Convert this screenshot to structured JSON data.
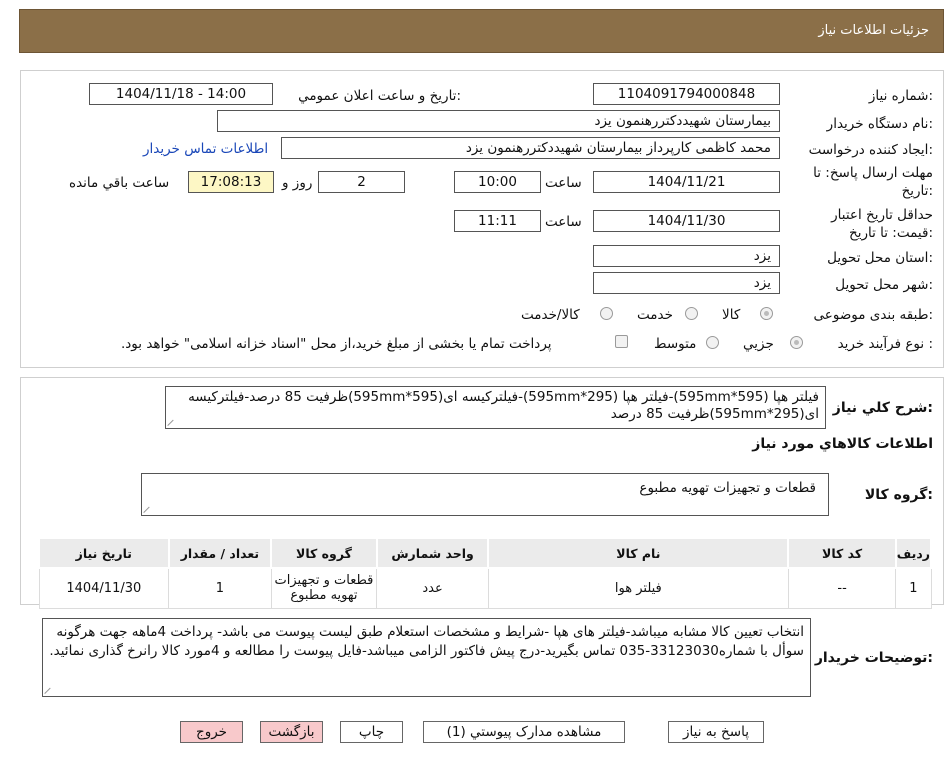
{
  "header": {
    "title": "جزئيات اطلاعات نياز"
  },
  "form": {
    "need_number_label": "شماره نياز:",
    "need_number": "1104091794000848",
    "announce_label": "تاريخ و ساعت اعلان عمومي:",
    "announce_value": "1404/11/18 - 14:00",
    "buyer_org_label": "نام دستگاه خريدار:",
    "buyer_org": "بیمارستان شهیددکتررهنمون یزد",
    "requester_label": "ايجاد کننده درخواست:",
    "requester": "محمد کاظمی کارپرداز بیمارستان شهیددکتررهنمون یزد",
    "contact_link": "اطلاعات تماس خريدار",
    "reply_deadline_label_1": "مهلت ارسال پاسخ: تا",
    "reply_deadline_label_2": "تاريخ:",
    "reply_date": "1404/11/21",
    "time_label": "ساعت",
    "reply_time": "10:00",
    "days_value": "2",
    "days_label": "روز و",
    "remaining_time": "17:08:13",
    "remaining_label": "ساعت باقي مانده",
    "validity_label_1": "حداقل تاريخ اعتبار",
    "validity_label_2": "قيمت: تا تاريخ:",
    "validity_date": "1404/11/30",
    "validity_time": "11:11",
    "province_label": "استان محل تحويل:",
    "province": "یزد",
    "city_label": "شهر محل تحويل:",
    "city": "یزد",
    "category_label": "طبقه بندی موضوعی:",
    "category_options": [
      "کالا",
      "خدمت",
      "کالا/خدمت"
    ],
    "category_selected": "کالا",
    "process_label": "نوع فرآيند خريد :",
    "process_options": [
      "جزيي",
      "متوسط"
    ],
    "process_selected": "جزيي",
    "payment_note": "پرداخت تمام يا بخشی از مبلغ خريد،از محل \"اسناد خزانه اسلامی\" خواهد بود."
  },
  "summary": {
    "label": "شرح کلي نياز:",
    "text": "فیلتر هپا (595*595mm)-فیلتر هپا (295*595mm)-فیلترکیسه ای(595*595mm)ظرفیت 85 درصد-فیلترکیسه ای(295*595mm)ظرفیت 85 درصد"
  },
  "goods": {
    "section_title": "اطلاعات کالاهاي مورد نياز",
    "group_label": "گروه کالا:",
    "group_value": "قطعات و تجهیزات تهویه مطبوع",
    "table": {
      "headers": [
        "رديف",
        "کد کالا",
        "نام کالا",
        "واحد شمارش",
        "گروه کالا",
        "تعداد / مقدار",
        "تاريخ نياز"
      ],
      "rows": [
        [
          "1",
          "--",
          "فیلتر هوا",
          "عدد",
          "قطعات و تجهیزات تهویه مطبوع",
          "1",
          "1404/11/30"
        ]
      ]
    }
  },
  "notes": {
    "label": "توضيحات خريدار:",
    "text": "انتخاب تعیین کالا مشابه میباشد-فیلتر های هپا -شرایط و مشخصات استعلام طبق لیست پیوست می باشد- پرداخت 4ماهه جهت هرگونه سوأل با شماره33123030-035 تماس بگیرید-درج پیش فاکتور الزامی میباشد-فایل پیوست را مطالعه و 4مورد کالا رانرخ گذاری نمائید."
  },
  "buttons": {
    "reply": "پاسخ به نياز",
    "attachments": "مشاهده مدارک پيوستي (1)",
    "print": "چاپ",
    "back": "بازگشت",
    "exit": "خروج"
  },
  "colors": {
    "header_bg": "#8b6f48",
    "link": "#1a47b8",
    "remaining_bg": "#fdf7c5",
    "back_exit_bg": "#f8c9cb"
  }
}
